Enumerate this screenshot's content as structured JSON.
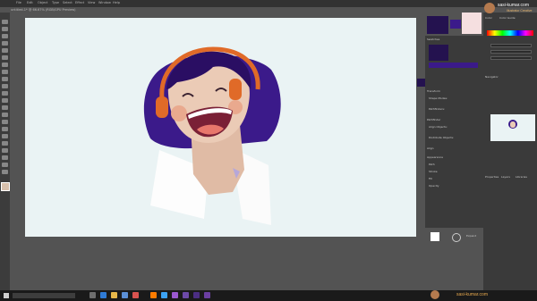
{
  "app": {
    "menu": [
      "File",
      "Edit",
      "Object",
      "Type",
      "Select",
      "Effect",
      "View",
      "Window",
      "Help"
    ],
    "doc_tab": "untitled-1* @ 66.67% (RGB/GPU Preview)"
  },
  "watermark": {
    "top_name": "sasi-kumar.com",
    "top_sub": "Illustrator Creative",
    "bottom": "sasi-kumar.com"
  },
  "panels": {
    "right": {
      "tabs": [
        "Swatches",
        "Brushes",
        "Symbols"
      ],
      "sections": [
        "Transform",
        "Pathfinder",
        "Align",
        "Appearance"
      ],
      "labels": [
        "Shape Modes:",
        "Pathfinders:",
        "Align Objects:",
        "Distribute Objects:",
        "Path",
        "Stroke",
        "Fill",
        "Opacity"
      ],
      "buttons": [
        "Expand"
      ]
    },
    "far": {
      "tabs": [
        "Color",
        "Color Guide"
      ],
      "sections": [
        "Navigator",
        "Properties",
        "Layers",
        "Libraries"
      ]
    }
  },
  "icons": {
    "tools": [
      "selection-tool-icon",
      "direct-selection-icon",
      "pen-tool-icon",
      "type-tool-icon",
      "line-tool-icon",
      "rectangle-tool-icon",
      "paintbrush-tool-icon",
      "pencil-tool-icon",
      "eraser-tool-icon",
      "rotate-tool-icon",
      "scale-tool-icon",
      "width-tool-icon",
      "shape-builder-icon",
      "gradient-tool-icon",
      "eyedropper-tool-icon",
      "blend-tool-icon",
      "symbol-sprayer-icon",
      "graph-tool-icon",
      "artboard-tool-icon",
      "slice-tool-icon",
      "hand-tool-icon",
      "zoom-tool-icon"
    ]
  },
  "colors": {
    "hair": "#3b1a8a",
    "hair_dark": "#2a0e63",
    "skin": "#e8c7b0",
    "skin_shadow": "#d8b09a",
    "cheek": "#e9a98e",
    "headphone": "#e06a28",
    "shirt": "#fdfdfd",
    "artboard": "#eaf3f4",
    "mouth": "#7a2036",
    "tongue": "#e8776c"
  }
}
